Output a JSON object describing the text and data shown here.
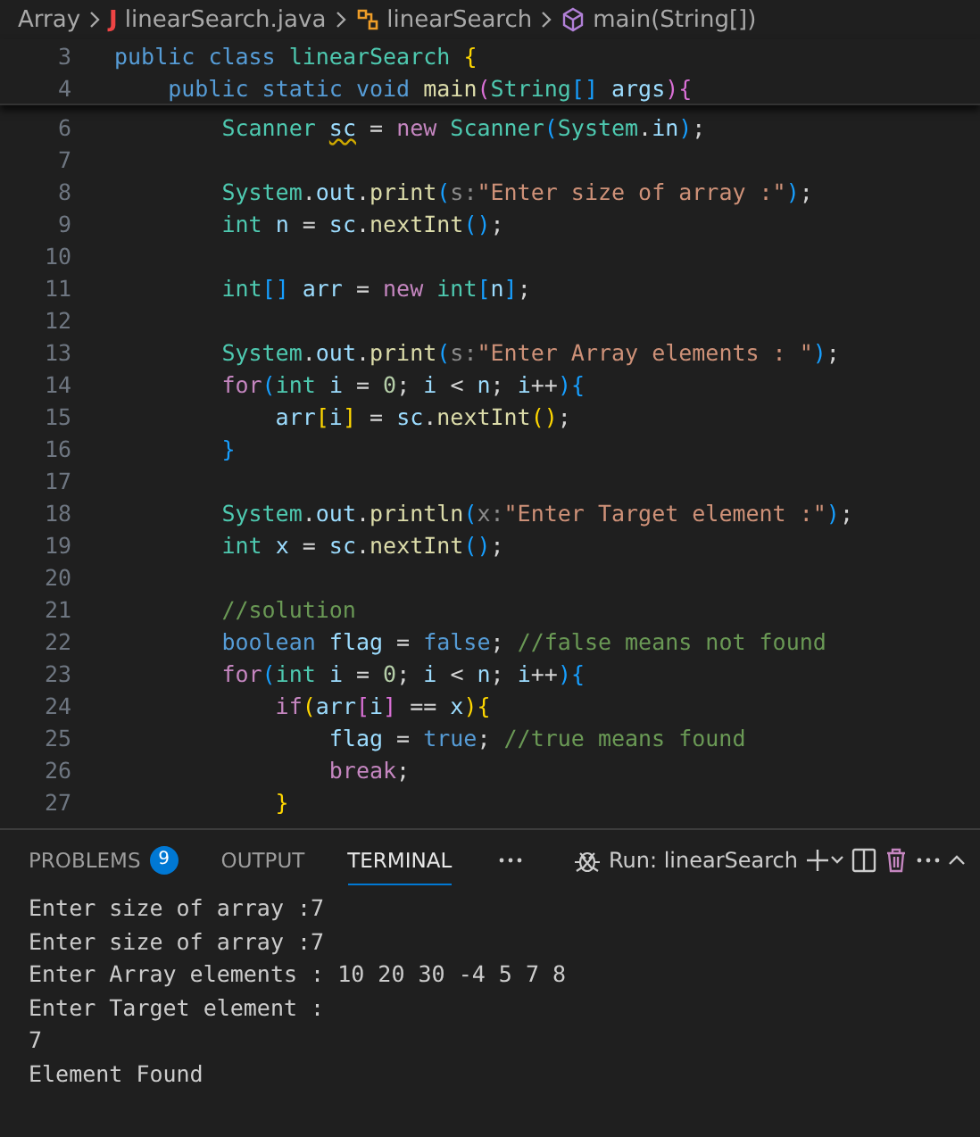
{
  "breadcrumb": [
    {
      "label": "Array",
      "kind": "folder"
    },
    {
      "label": "linearSearch.java",
      "kind": "file",
      "icon_text": "J"
    },
    {
      "label": "linearSearch",
      "kind": "class"
    },
    {
      "label": "main(String[])",
      "kind": "method"
    }
  ],
  "sticky_lines": [
    {
      "number": "3",
      "tokens": [
        {
          "t": "public ",
          "kind": "storage"
        },
        {
          "t": "class ",
          "kind": "storage"
        },
        {
          "t": "linearSearch ",
          "kind": "type"
        },
        {
          "t": "{",
          "kind": "b1"
        }
      ]
    },
    {
      "number": "4",
      "tokens": [
        {
          "t": "    public ",
          "kind": "storage"
        },
        {
          "t": "static ",
          "kind": "storage"
        },
        {
          "t": "void ",
          "kind": "storage"
        },
        {
          "t": "main",
          "kind": "fn"
        },
        {
          "t": "(",
          "kind": "b2"
        },
        {
          "t": "String",
          "kind": "type"
        },
        {
          "t": "[] ",
          "kind": "b3"
        },
        {
          "t": "args",
          "kind": "var"
        },
        {
          "t": "){",
          "kind": "b2"
        }
      ]
    }
  ],
  "code_lines": [
    {
      "number": "6",
      "tokens": [
        {
          "t": "        Scanner ",
          "kind": "type"
        },
        {
          "t": "sc",
          "kind": "warn"
        },
        {
          "t": " = ",
          "kind": "plain"
        },
        {
          "t": "new ",
          "kind": "kw"
        },
        {
          "t": "Scanner",
          "kind": "type"
        },
        {
          "t": "(",
          "kind": "b3"
        },
        {
          "t": "System",
          "kind": "type"
        },
        {
          "t": ".",
          "kind": "plain"
        },
        {
          "t": "in",
          "kind": "var"
        },
        {
          "t": ")",
          "kind": "b3"
        },
        {
          "t": ";",
          "kind": "plain"
        }
      ]
    },
    {
      "number": "7"
    },
    {
      "number": "8",
      "tokens": [
        {
          "t": "        System",
          "kind": "type"
        },
        {
          "t": ".",
          "kind": "plain"
        },
        {
          "t": "out",
          "kind": "var"
        },
        {
          "t": ".",
          "kind": "plain"
        },
        {
          "t": "print",
          "kind": "fn"
        },
        {
          "t": "(",
          "kind": "b3"
        },
        {
          "t": "s:",
          "kind": "hint"
        },
        {
          "t": "\"Enter size of array :\"",
          "kind": "str"
        },
        {
          "t": ")",
          "kind": "b3"
        },
        {
          "t": ";",
          "kind": "plain"
        }
      ]
    },
    {
      "number": "9",
      "tokens": [
        {
          "t": "        int ",
          "kind": "type"
        },
        {
          "t": "n",
          "kind": "var"
        },
        {
          "t": " = ",
          "kind": "plain"
        },
        {
          "t": "sc",
          "kind": "var"
        },
        {
          "t": ".",
          "kind": "plain"
        },
        {
          "t": "nextInt",
          "kind": "fn"
        },
        {
          "t": "()",
          "kind": "b3"
        },
        {
          "t": ";",
          "kind": "plain"
        }
      ]
    },
    {
      "number": "10"
    },
    {
      "number": "11",
      "tokens": [
        {
          "t": "        int",
          "kind": "type"
        },
        {
          "t": "[] ",
          "kind": "b3"
        },
        {
          "t": "arr",
          "kind": "var"
        },
        {
          "t": " = ",
          "kind": "plain"
        },
        {
          "t": "new ",
          "kind": "kw"
        },
        {
          "t": "int",
          "kind": "type"
        },
        {
          "t": "[",
          "kind": "b3"
        },
        {
          "t": "n",
          "kind": "var"
        },
        {
          "t": "]",
          "kind": "b3"
        },
        {
          "t": ";",
          "kind": "plain"
        }
      ]
    },
    {
      "number": "12"
    },
    {
      "number": "13",
      "tokens": [
        {
          "t": "        System",
          "kind": "type"
        },
        {
          "t": ".",
          "kind": "plain"
        },
        {
          "t": "out",
          "kind": "var"
        },
        {
          "t": ".",
          "kind": "plain"
        },
        {
          "t": "print",
          "kind": "fn"
        },
        {
          "t": "(",
          "kind": "b3"
        },
        {
          "t": "s:",
          "kind": "hint"
        },
        {
          "t": "\"Enter Array elements : \"",
          "kind": "str"
        },
        {
          "t": ")",
          "kind": "b3"
        },
        {
          "t": ";",
          "kind": "plain"
        }
      ]
    },
    {
      "number": "14",
      "tokens": [
        {
          "t": "        for",
          "kind": "kw"
        },
        {
          "t": "(",
          "kind": "b3"
        },
        {
          "t": "int ",
          "kind": "type"
        },
        {
          "t": "i",
          "kind": "var"
        },
        {
          "t": " = ",
          "kind": "plain"
        },
        {
          "t": "0",
          "kind": "num"
        },
        {
          "t": "; ",
          "kind": "plain"
        },
        {
          "t": "i",
          "kind": "var"
        },
        {
          "t": " < ",
          "kind": "plain"
        },
        {
          "t": "n",
          "kind": "var"
        },
        {
          "t": "; ",
          "kind": "plain"
        },
        {
          "t": "i",
          "kind": "var"
        },
        {
          "t": "++",
          "kind": "plain"
        },
        {
          "t": "){",
          "kind": "b3"
        }
      ]
    },
    {
      "number": "15",
      "tokens": [
        {
          "t": "            arr",
          "kind": "var"
        },
        {
          "t": "[",
          "kind": "b1"
        },
        {
          "t": "i",
          "kind": "var"
        },
        {
          "t": "]",
          "kind": "b1"
        },
        {
          "t": " = ",
          "kind": "plain"
        },
        {
          "t": "sc",
          "kind": "var"
        },
        {
          "t": ".",
          "kind": "plain"
        },
        {
          "t": "nextInt",
          "kind": "fn"
        },
        {
          "t": "()",
          "kind": "b1"
        },
        {
          "t": ";",
          "kind": "plain"
        }
      ]
    },
    {
      "number": "16",
      "tokens": [
        {
          "t": "        }",
          "kind": "b3"
        }
      ]
    },
    {
      "number": "17"
    },
    {
      "number": "18",
      "tokens": [
        {
          "t": "        System",
          "kind": "type"
        },
        {
          "t": ".",
          "kind": "plain"
        },
        {
          "t": "out",
          "kind": "var"
        },
        {
          "t": ".",
          "kind": "plain"
        },
        {
          "t": "println",
          "kind": "fn"
        },
        {
          "t": "(",
          "kind": "b3"
        },
        {
          "t": "x:",
          "kind": "hint"
        },
        {
          "t": "\"Enter Target element :\"",
          "kind": "str"
        },
        {
          "t": ")",
          "kind": "b3"
        },
        {
          "t": ";",
          "kind": "plain"
        }
      ]
    },
    {
      "number": "19",
      "tokens": [
        {
          "t": "        int ",
          "kind": "type"
        },
        {
          "t": "x",
          "kind": "var"
        },
        {
          "t": " = ",
          "kind": "plain"
        },
        {
          "t": "sc",
          "kind": "var"
        },
        {
          "t": ".",
          "kind": "plain"
        },
        {
          "t": "nextInt",
          "kind": "fn"
        },
        {
          "t": "()",
          "kind": "b3"
        },
        {
          "t": ";",
          "kind": "plain"
        }
      ]
    },
    {
      "number": "20"
    },
    {
      "number": "21",
      "tokens": [
        {
          "t": "        //solution",
          "kind": "com"
        }
      ]
    },
    {
      "number": "22",
      "tokens": [
        {
          "t": "        boolean ",
          "kind": "storage"
        },
        {
          "t": "flag",
          "kind": "var"
        },
        {
          "t": " = ",
          "kind": "plain"
        },
        {
          "t": "false",
          "kind": "storage"
        },
        {
          "t": "; ",
          "kind": "plain"
        },
        {
          "t": "//false means not found",
          "kind": "com"
        }
      ]
    },
    {
      "number": "23",
      "tokens": [
        {
          "t": "        for",
          "kind": "kw"
        },
        {
          "t": "(",
          "kind": "b3"
        },
        {
          "t": "int ",
          "kind": "type"
        },
        {
          "t": "i",
          "kind": "var"
        },
        {
          "t": " = ",
          "kind": "plain"
        },
        {
          "t": "0",
          "kind": "num"
        },
        {
          "t": "; ",
          "kind": "plain"
        },
        {
          "t": "i",
          "kind": "var"
        },
        {
          "t": " < ",
          "kind": "plain"
        },
        {
          "t": "n",
          "kind": "var"
        },
        {
          "t": "; ",
          "kind": "plain"
        },
        {
          "t": "i",
          "kind": "var"
        },
        {
          "t": "++",
          "kind": "plain"
        },
        {
          "t": "){",
          "kind": "b3"
        }
      ]
    },
    {
      "number": "24",
      "tokens": [
        {
          "t": "            if",
          "kind": "kw"
        },
        {
          "t": "(",
          "kind": "b1"
        },
        {
          "t": "arr",
          "kind": "var"
        },
        {
          "t": "[",
          "kind": "b2"
        },
        {
          "t": "i",
          "kind": "var"
        },
        {
          "t": "]",
          "kind": "b2"
        },
        {
          "t": " == ",
          "kind": "plain"
        },
        {
          "t": "x",
          "kind": "var"
        },
        {
          "t": "){",
          "kind": "b1"
        }
      ]
    },
    {
      "number": "25",
      "tokens": [
        {
          "t": "                flag",
          "kind": "var"
        },
        {
          "t": " = ",
          "kind": "plain"
        },
        {
          "t": "true",
          "kind": "storage"
        },
        {
          "t": "; ",
          "kind": "plain"
        },
        {
          "t": "//true means found",
          "kind": "com"
        }
      ]
    },
    {
      "number": "26",
      "tokens": [
        {
          "t": "                break",
          "kind": "kw"
        },
        {
          "t": ";",
          "kind": "plain"
        }
      ]
    },
    {
      "number": "27",
      "tokens": [
        {
          "t": "            }",
          "kind": "b1"
        }
      ]
    }
  ],
  "panel": {
    "tabs": [
      {
        "label": "PROBLEMS",
        "badge": "9",
        "selected": false
      },
      {
        "label": "OUTPUT",
        "selected": false
      },
      {
        "label": "TERMINAL",
        "selected": true
      }
    ],
    "terminal_name": "Run: linearSearch",
    "terminal_lines": [
      "Enter size of array :7",
      "Enter size of array :7",
      "Enter Array elements : 10 20 30 -4 5 7 8",
      "Enter Target element :",
      "7",
      "Element Found"
    ]
  }
}
